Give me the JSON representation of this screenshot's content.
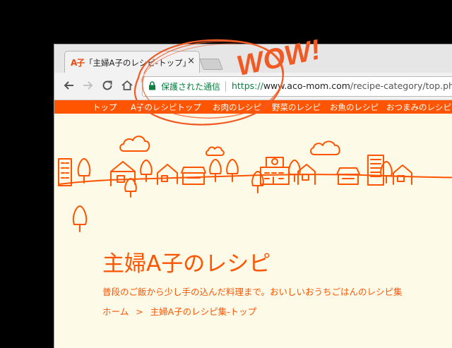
{
  "browser": {
    "tab": {
      "favicon": "A子",
      "title": "「主婦A子のレシピ-トップ」",
      "close_icon": "×"
    },
    "address_bar": {
      "secure_label": "保護された通信",
      "url_scheme": "https://",
      "url_host": "www.aco-mom.com",
      "url_path": "/recipe-category/top.php"
    }
  },
  "site_nav": {
    "items": [
      "トップ",
      "A子のレシピトップ",
      "お肉のレシピ",
      "野菜のレシピ",
      "お魚のレシピ",
      "おつまみのレシピ"
    ]
  },
  "page": {
    "title": "主婦A子のレシピ",
    "tagline": "普段のご飯から少し手の込んだ料理まで。おいしいおうちごはんのレシピ集",
    "breadcrumb": {
      "home": "ホーム",
      "separator": ">",
      "current": "主婦A子のレシピ集-トップ"
    }
  },
  "annotation": {
    "text": "WOW!"
  },
  "colors": {
    "brand": "#ff5400",
    "page_background": "#fdfae8",
    "secure_green": "#0b8043"
  }
}
